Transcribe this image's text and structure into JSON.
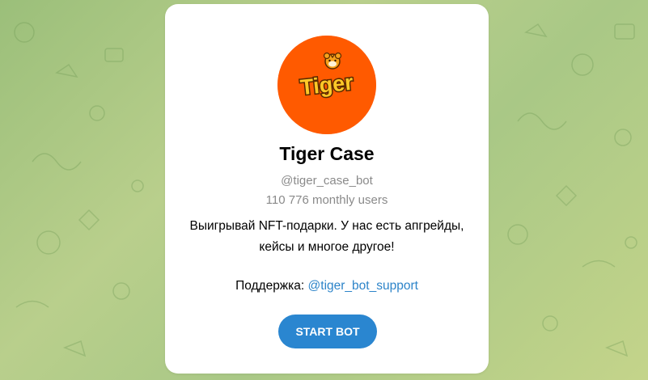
{
  "bot": {
    "avatar_logo_text": "Tiger",
    "name": "Tiger Case",
    "username": "@tiger_case_bot",
    "monthly_users": "110 776 monthly users",
    "description_line1": "Выигрывай NFT-подарки. У нас есть апгрейды,",
    "description_line2": "кейсы и многое другое!",
    "support_label": "Поддержка:",
    "support_link": "@tiger_bot_support",
    "start_button_label": "START BOT"
  },
  "colors": {
    "avatar_bg": "#ff5a00",
    "link": "#2d84c9",
    "button": "#2a86d0",
    "muted_text": "#8a8a8a"
  },
  "icons": [
    "tiger-logo-icon",
    "doodle-pattern-background"
  ]
}
